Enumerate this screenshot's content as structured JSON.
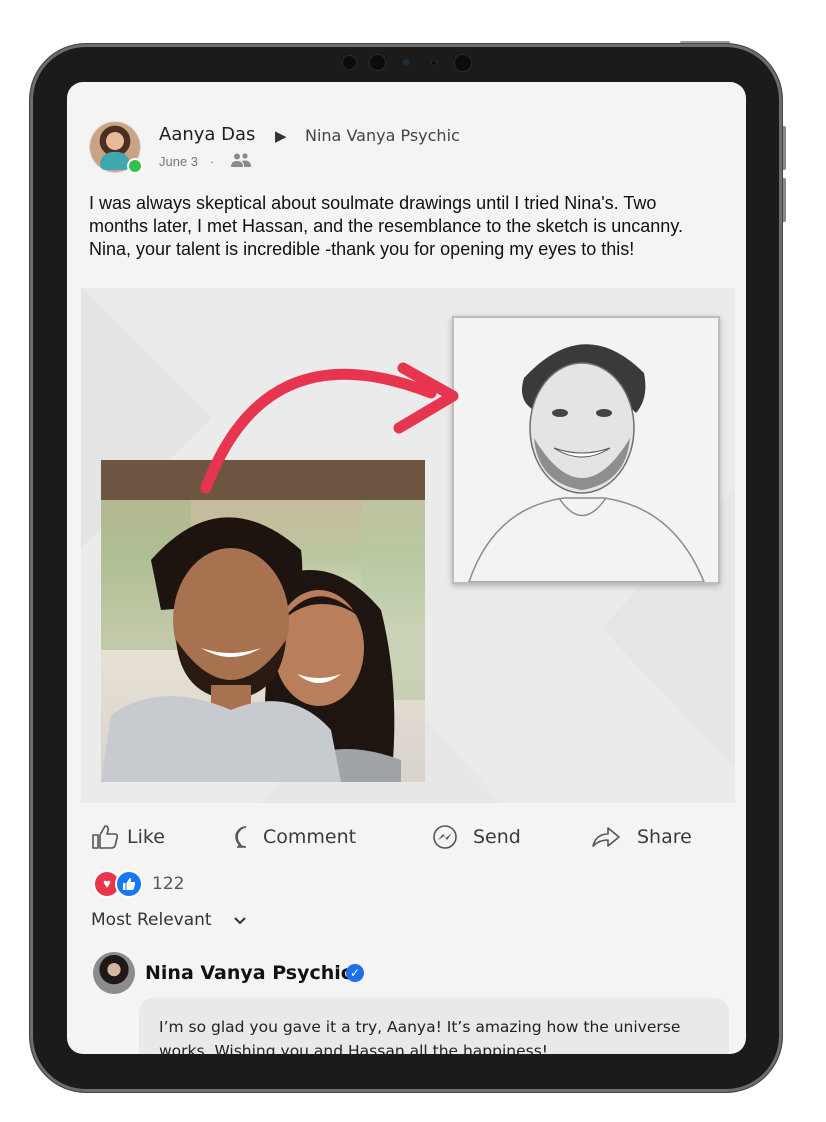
{
  "post": {
    "author": "Aanya Das",
    "share_arrow": "▶",
    "target_page": "Nina Vanya Psychic",
    "date": "June 3",
    "separator": "·",
    "text": "I was always skeptical about soulmate drawings until I tried Nina's. Two months later, I met Hassan, and the resemblance to the sketch is uncanny. Nina, your talent is incredible -thank you for opening my eyes to this!"
  },
  "actions": {
    "like": "Like",
    "comment": "Comment",
    "send": "Send",
    "share": "Share"
  },
  "reactions": {
    "count": "122"
  },
  "comments": {
    "sort_label": "Most Relevant",
    "items": [
      {
        "name": "Nina Vanya Psychic",
        "text": "I’m so glad you gave it a try, Aanya! It’s amazing how the universe works. Wishing you and Hassan all the happiness!"
      }
    ]
  },
  "colors": {
    "arrow": "#e8354f",
    "verified": "#1f6feb",
    "like_blue": "#1877f2",
    "love_red": "#e8364c",
    "online_green": "#31c24a"
  }
}
